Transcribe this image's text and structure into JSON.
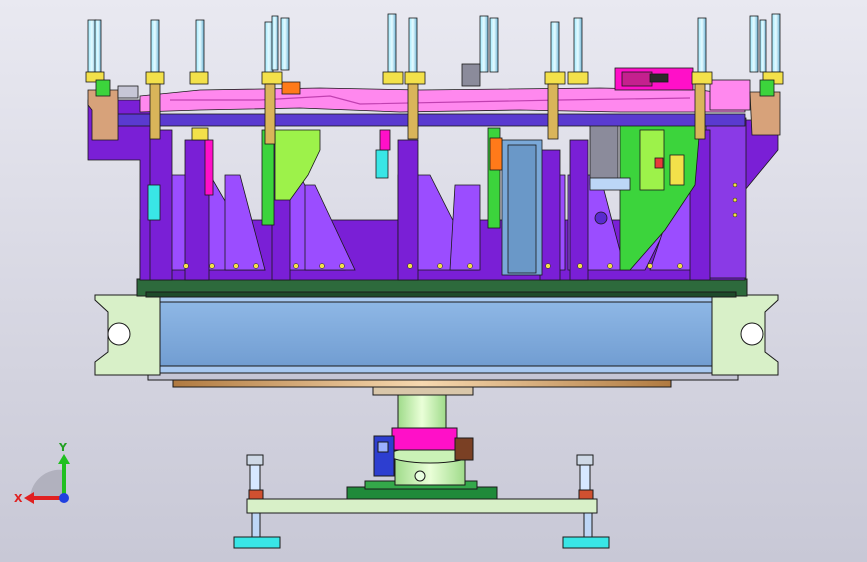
{
  "viewport": {
    "background_top": "#e9e9f1",
    "background_bottom": "#c8c8d6"
  },
  "colors": {
    "outline": "#1a1a1a",
    "purple": "#7a1fd6",
    "violet": "#9b4dff",
    "pink": "#ff88ee",
    "magenta": "#ff10c8",
    "green": "#3cd43c",
    "lime": "#9df24a",
    "dark_green": "#2d6a3c",
    "steel_blue": "#7aa8d8",
    "pale_green": "#d8f0c8",
    "cyan": "#39e6e6",
    "orange": "#ff7a1a",
    "tan": "#d7a27a",
    "gray": "#8b8b9b",
    "red": "#e83a3a",
    "yellow": "#f3e14a",
    "navy": "#2d3ed0"
  },
  "model": {
    "name": "welding-fixture-assembly",
    "view": "front"
  },
  "triad": {
    "x_label": "X",
    "y_label": "Y",
    "x_color": "#e02020",
    "y_color": "#20c020",
    "z_color": "#2040e0"
  }
}
